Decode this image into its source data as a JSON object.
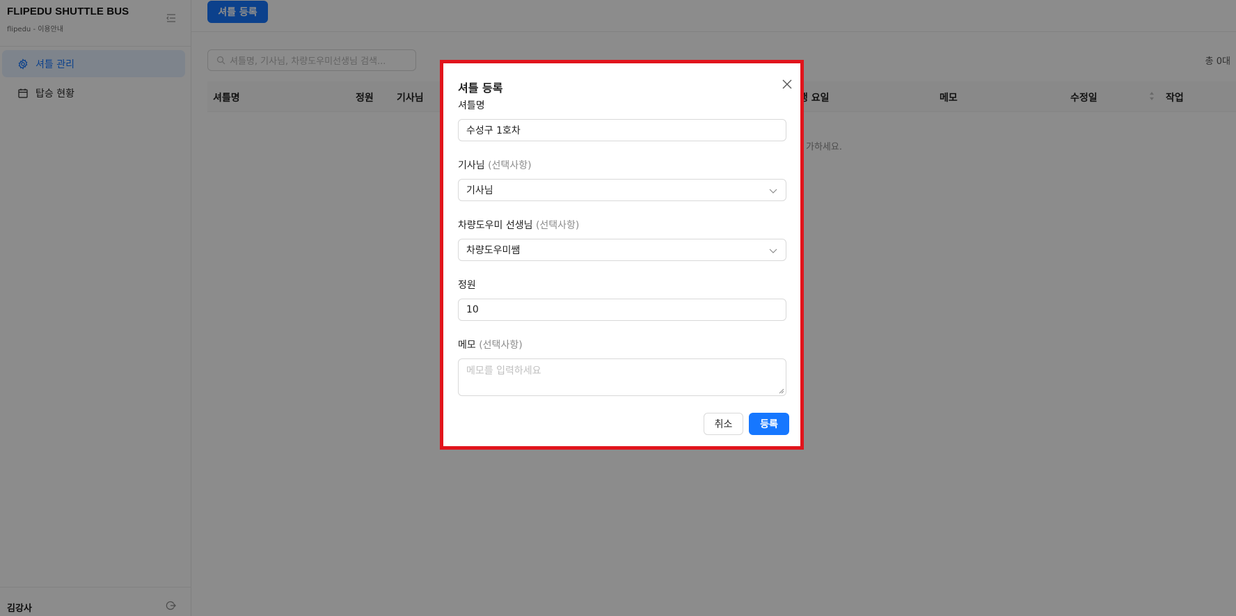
{
  "sidebar": {
    "brand_title": "FLIPEDU SHUTTLE BUS",
    "brand_sub": "flipedu - 이용안내",
    "items": [
      {
        "label": "셔틀 관리",
        "icon": "gear-icon",
        "active": true
      },
      {
        "label": "탑승 현황",
        "icon": "calendar-icon",
        "active": false
      }
    ],
    "user_name": "김강사"
  },
  "toolbar": {
    "register_label": "셔틀 등록"
  },
  "search": {
    "placeholder": "셔틀명, 기사님, 차량도우미선생님 검색..."
  },
  "summary": {
    "total": "총 0대"
  },
  "table": {
    "columns": [
      "셔틀명",
      "정원",
      "기사님",
      "행 요일",
      "메모",
      "수정일",
      "작업"
    ],
    "empty_text": "가하세요."
  },
  "modal": {
    "title": "셔틀 등록",
    "fields": {
      "name": {
        "label": "셔틀명",
        "value": "수성구 1호차"
      },
      "driver": {
        "label": "기사님",
        "optional": "(선택사항)",
        "value": "기사님"
      },
      "assistant": {
        "label": "차량도우미 선생님",
        "optional": "(선택사항)",
        "value": "차량도우미쌤"
      },
      "capacity": {
        "label": "정원",
        "value": "10"
      },
      "memo": {
        "label": "메모",
        "optional": "(선택사항)",
        "placeholder": "메모를 입력하세요"
      }
    },
    "cancel_label": "취소",
    "submit_label": "등록"
  },
  "colors": {
    "primary": "#1677ff",
    "highlight_border": "#e1141c"
  }
}
